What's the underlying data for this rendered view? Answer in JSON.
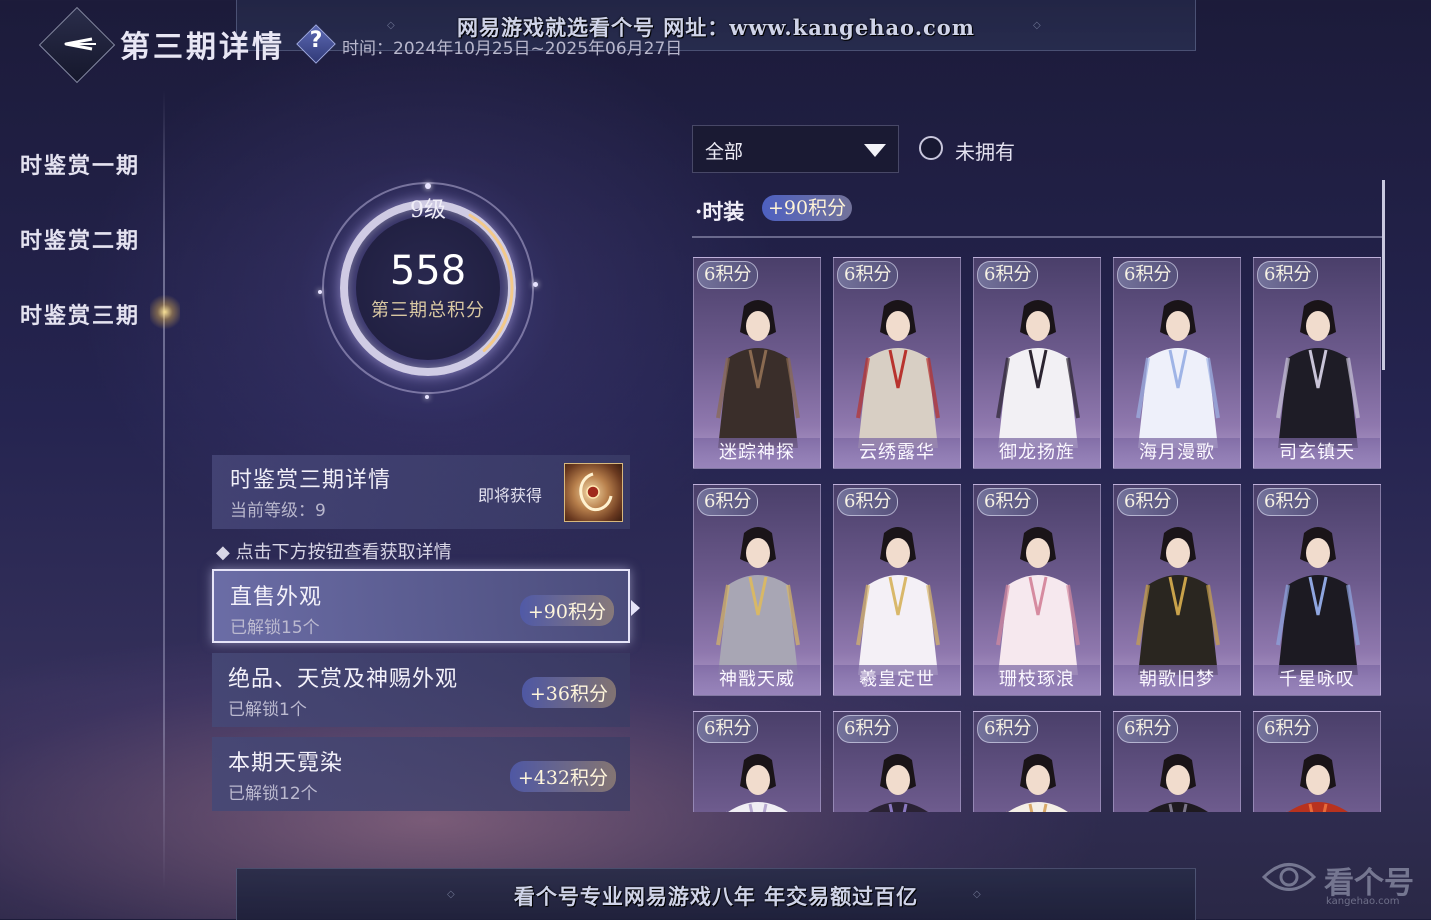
{
  "header": {
    "watermark_top": "网易游戏就选看个号  网址：www.kangehao.com",
    "title": "第三期详情",
    "help_symbol": "?",
    "time_text": "时间：2024年10月25日~2025年06月27日",
    "back_icon": "back-arrow-icon"
  },
  "sidebar": {
    "items": [
      {
        "label": "时鉴赏一期"
      },
      {
        "label": "时鉴赏二期"
      },
      {
        "label": "时鉴赏三期",
        "selected": true
      }
    ]
  },
  "score": {
    "level": "9级",
    "total": "558",
    "label": "第三期总积分",
    "ring_progress": 0.3
  },
  "detail": {
    "title": "时鉴赏三期详情",
    "current_level": "当前等级：9",
    "soon_label": "即将获得"
  },
  "hint": "点击下方按钮查看获取详情",
  "categories": [
    {
      "title": "直售外观",
      "sub": "已解锁15个",
      "points": "+90积分",
      "active": true
    },
    {
      "title": "绝品、天赏及神赐外观",
      "sub": "已解锁1个",
      "points": "+36积分"
    },
    {
      "title": "本期天霓染",
      "sub": "已解锁12个",
      "points": "+432积分"
    }
  ],
  "filter": {
    "dropdown_value": "全部",
    "radio_label": "未拥有"
  },
  "section": {
    "label": "时装",
    "points": "+90积分"
  },
  "cards": [
    {
      "points": "6积分",
      "name": "迷踪神探",
      "outfit": "#3a2e2a",
      "accent": "#8a6a50"
    },
    {
      "points": "6积分",
      "name": "云绣露华",
      "outfit": "#d8cfc4",
      "accent": "#b8332e"
    },
    {
      "points": "6积分",
      "name": "御龙扬旌",
      "outfit": "#f2f0f4",
      "accent": "#2b2430"
    },
    {
      "points": "6积分",
      "name": "海月漫歌",
      "outfit": "#eef0fa",
      "accent": "#9fb4e6"
    },
    {
      "points": "6积分",
      "name": "司玄镇天",
      "outfit": "#1e1c26",
      "accent": "#c9c4d8"
    },
    {
      "points": "6积分",
      "name": "神戬天威",
      "outfit": "#a8a6b4",
      "accent": "#d8b866"
    },
    {
      "points": "6积分",
      "name": "羲皇定世",
      "outfit": "#f4f0f6",
      "accent": "#d9b86a"
    },
    {
      "points": "6积分",
      "name": "珊枝琢浪",
      "outfit": "#f6e8ee",
      "accent": "#d68ba0"
    },
    {
      "points": "6积分",
      "name": "朝歌旧梦",
      "outfit": "#2a2620",
      "accent": "#c9a24a"
    },
    {
      "points": "6积分",
      "name": "千星咏叹",
      "outfit": "#1c1a22",
      "accent": "#8fa6e0"
    },
    {
      "points": "6积分",
      "name": "",
      "outfit": "#f0eef4",
      "accent": "#b6a8d0"
    },
    {
      "points": "6积分",
      "name": "",
      "outfit": "#2a2234",
      "accent": "#8a78c0"
    },
    {
      "points": "6积分",
      "name": "",
      "outfit": "#f4eee6",
      "accent": "#d8a868"
    },
    {
      "points": "6积分",
      "name": "",
      "outfit": "#1e1a20",
      "accent": "#7a7488"
    },
    {
      "points": "6积分",
      "name": "",
      "outfit": "#b8321e",
      "accent": "#e86a3a"
    }
  ],
  "footer": {
    "banner": "看个号专业网易游戏八年  年交易额过百亿",
    "watermark": "看个号",
    "watermark_url": "kangehao.com"
  }
}
